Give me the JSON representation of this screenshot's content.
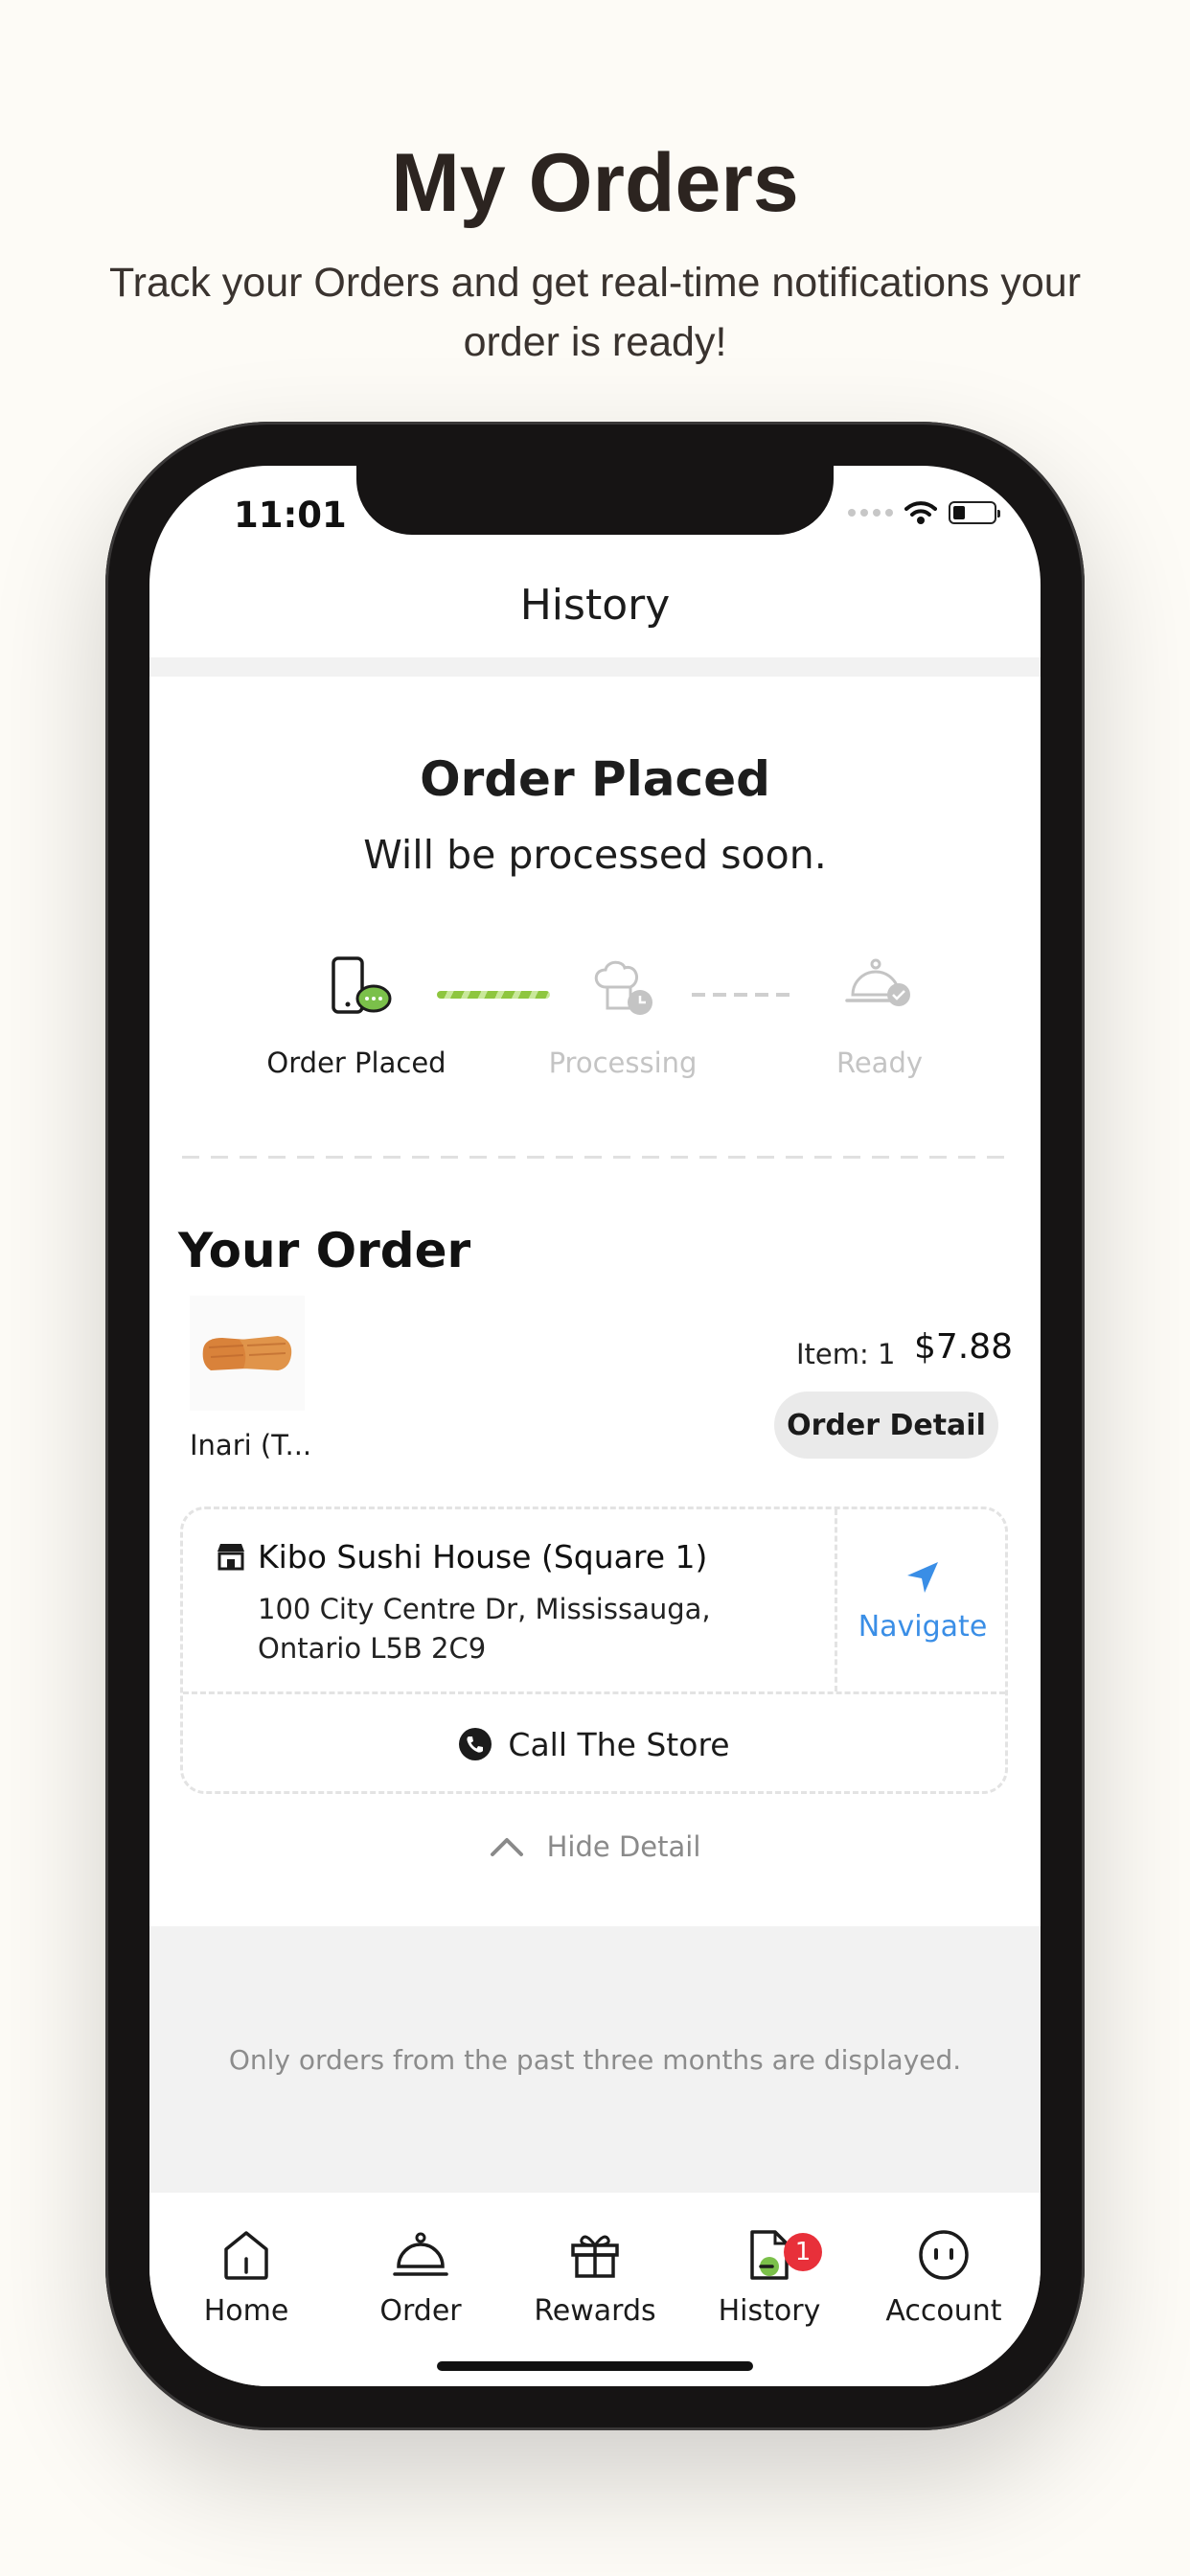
{
  "promo": {
    "title": "My Orders",
    "subtitle": "Track your Orders and get real-time notifications your order is ready!"
  },
  "status_bar": {
    "time": "11:01"
  },
  "nav": {
    "title": "History"
  },
  "order_status": {
    "title": "Order Placed",
    "subtitle": "Will be processed soon.",
    "steps": [
      {
        "label": "Order Placed",
        "state": "done",
        "icon": "phone-chat-icon"
      },
      {
        "label": "Processing",
        "state": "pending",
        "icon": "chef-clock-icon"
      },
      {
        "label": "Ready",
        "state": "pending",
        "icon": "cloche-check-icon"
      }
    ]
  },
  "your_order": {
    "heading": "Your Order",
    "item_name": "Inari (T...",
    "item_count": "Item: 1",
    "price": "$7.88",
    "detail_button": "Order Detail"
  },
  "store": {
    "name": "Kibo Sushi House (Square 1)",
    "address": "100 City Centre Dr, Mississauga, Ontario L5B 2C9",
    "navigate_label": "Navigate",
    "call_label": "Call The Store"
  },
  "hide_detail": "Hide Detail",
  "footer_note": "Only orders from the past three months are displayed.",
  "tabs": [
    {
      "label": "Home",
      "icon": "home-icon"
    },
    {
      "label": "Order",
      "icon": "cloche-icon"
    },
    {
      "label": "Rewards",
      "icon": "gift-icon"
    },
    {
      "label": "History",
      "icon": "receipt-icon",
      "badge": "1"
    },
    {
      "label": "Account",
      "icon": "account-icon"
    }
  ],
  "colors": {
    "accent_blue": "#3a8ee6",
    "progress_green": "#8ec63f",
    "badge_red": "#e8303a",
    "inactive_gray": "#c4c4c4"
  }
}
